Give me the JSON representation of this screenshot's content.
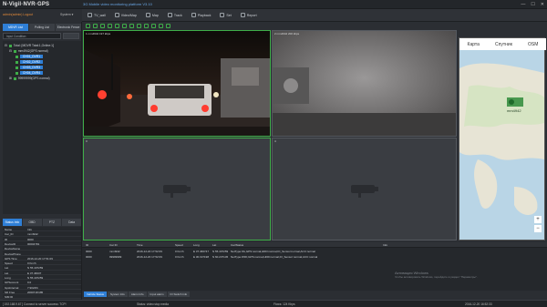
{
  "app": {
    "logo": "N-Vigil·NVR·GPS",
    "title": "3G Mobile video monitoring platform V3.10",
    "user_line": "admin(admin)  Logout",
    "system_menu": "System"
  },
  "toolbar": {
    "items": [
      {
        "label": "TV_wall",
        "icon": "tv-icon"
      },
      {
        "label": "Video/Map",
        "icon": "video-map-icon"
      },
      {
        "label": "Map",
        "icon": "map-pin-icon"
      },
      {
        "label": "Track",
        "icon": "track-icon"
      },
      {
        "label": "Playback",
        "icon": "playback-icon"
      },
      {
        "label": "Set",
        "icon": "gear-icon"
      },
      {
        "label": "Report",
        "icon": "report-icon"
      }
    ]
  },
  "left_tabs": [
    "MDVR List",
    "Polling List",
    "Electronic Fence"
  ],
  "search": {
    "placeholder": "Input Condition"
  },
  "tree": {
    "root": "Total: [MDVR Total:1,Online:1]",
    "device": "mm4942(GPS normal)",
    "channels": [
      "CH01_DVR1",
      "CH02_DVR2",
      "CH03_DVR3",
      "CH04_DVR4"
    ],
    "device2": "99999999(GPS normal)"
  },
  "video": {
    "panels": [
      {
        "label": "1 mm4942   197 kbps"
      },
      {
        "label": "2 mm4942   200 kbps"
      },
      {
        "label": "3"
      },
      {
        "label": "4"
      }
    ]
  },
  "map": {
    "tabs": [
      "Карта",
      "Спутник",
      "OSM"
    ],
    "marker_label": "mm4942",
    "controls": {
      "zoom_in": "+",
      "zoom_out": "−"
    }
  },
  "props": {
    "tabs": [
      "Status Info",
      "OBD",
      "PTZ",
      "Data"
    ],
    "rows": [
      {
        "k": "Name",
        "v": "Info"
      },
      {
        "k": "Car_ID",
        "v": "mm4942"
      },
      {
        "k": "ID",
        "v": "0000"
      },
      {
        "k": "DeviceID",
        "v": "00004781"
      },
      {
        "k": "DeviceName",
        "v": ""
      },
      {
        "k": "DevicePhone",
        "v": ""
      },
      {
        "k": "GPS Time",
        "v": "2016-12-20 17:51:09"
      },
      {
        "k": "Speed",
        "v": "0 Km/h"
      },
      {
        "k": "Lat",
        "v": "N 55.407259"
      },
      {
        "k": "Lat",
        "v": "E 37.46637"
      },
      {
        "k": "Long",
        "v": "N 55.407259"
      },
      {
        "k": "GPSocount",
        "v": "0.0"
      },
      {
        "k": "GpsInterval",
        "v": "7.9024%"
      },
      {
        "k": "SD Free",
        "v": "2060718 MB"
      },
      {
        "k": "SIM ID",
        "v": ""
      }
    ]
  },
  "table": {
    "headers": [
      "ID",
      "Car ID",
      "Time",
      "Speed",
      "Long",
      "Lat",
      "Car/Status",
      "Info"
    ],
    "rows": [
      [
        "0000",
        "mm4942",
        "2016-12-20 17:52:09",
        "0 Km/h",
        "E 37.466747",
        "N 55.407259",
        "NetType:3G,GPS:normal,HDD:normal,IO_Sensor:normal,ACC:normal",
        ""
      ],
      [
        "0000",
        "99999999",
        "2016-12-20 17:52:09",
        "0 Km/h",
        "E 30.197198",
        "N 60.237145",
        "NetType:WIFI,GPS:normal,HDD:normal,IO_Sensor:normal,ACC:normal",
        ""
      ]
    ]
  },
  "bottom_tabs": [
    "Vehicle Status",
    "System Info",
    "Alarm Info",
    "Input alarm",
    "IO Switch Info"
  ],
  "watermark": {
    "line1": "Активация Windows",
    "line2": "Чтобы активировать Windows, перейдите в раздел \"Параметры\"."
  },
  "status": {
    "left": "[ 192.168.9.67 ]   Connect to server success: TCP!",
    "mid": "Status: video:stop media",
    "flow": "Flows: 124 Kbps",
    "time": "2016-12-20 16:52:33"
  }
}
